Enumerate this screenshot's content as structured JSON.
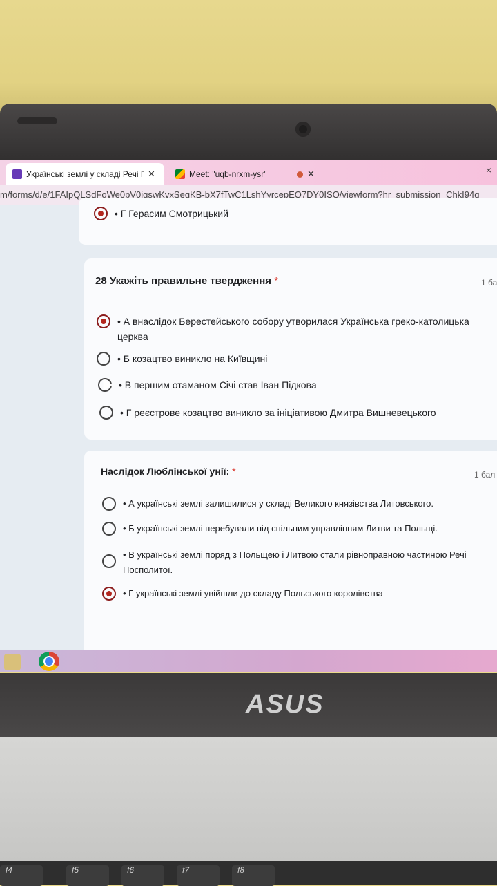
{
  "browser": {
    "tabs": [
      {
        "title": "Українські землі у складі Речі По"
      },
      {
        "title": "Meet: \"uqb-nrxm-ysr\""
      }
    ],
    "window_close": "×",
    "url": "m/forms/d/e/1FAIpQLSdFoWe0pV0jgswKvxSegKB-bX7fTwC1LshYyrcepEQ7DY0ISQ/viewform?hr_submission=ChkI94q"
  },
  "form": {
    "previous_option": "• Г Герасим Смотрицький",
    "questions": [
      {
        "number": "28",
        "title": "Укажіть правильне твердження",
        "required": "*",
        "points": "1 ба",
        "options": [
          {
            "label": "• А внаслідок Берестейського собору утворилася Українська греко-католицька церква",
            "selected": true
          },
          {
            "label": "• Б козацтво виникло на Київщині",
            "selected": false
          },
          {
            "label": "• В першим отаманом Січі став Іван Підкова",
            "selected": false
          },
          {
            "label": "• Г реєстрове козацтво виникло за ініціативою Дмитра Вишневецького",
            "selected": false
          }
        ]
      },
      {
        "title": "Наслідок Люблінської унії:",
        "required": "*",
        "points": "1 бал",
        "options": [
          {
            "label": "• А українські землі залишилися у складі Великого князівства Литовського.",
            "selected": false
          },
          {
            "label": "• Б українські землі перебували під спільним управлінням Литви та Польщі.",
            "selected": false
          },
          {
            "label": "• В українські землі поряд з Польщею і Литвою стали рівноправною частиною Речі Посполитої.",
            "selected": false
          },
          {
            "label": "• Г українські землі увійшли до складу Польського королівства",
            "selected": true
          }
        ]
      }
    ]
  },
  "laptop": {
    "brand": "ASUS",
    "function_keys": [
      "f4",
      "f5",
      "f6",
      "f7",
      "f8"
    ]
  },
  "colors": {
    "selected_radio": "#b3261e",
    "required_star": "#d93025"
  }
}
